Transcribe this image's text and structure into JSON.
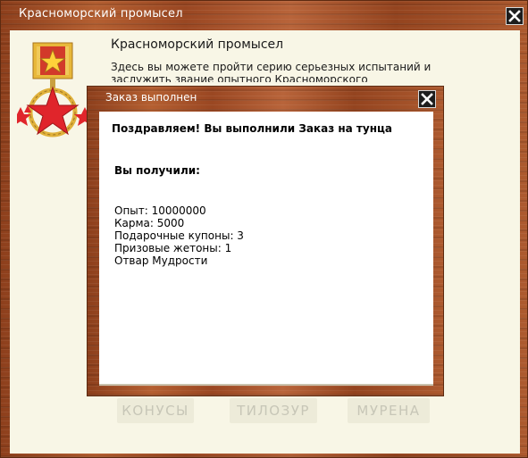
{
  "outer_window": {
    "title": "Красноморский промысел",
    "heading": "Красноморский промысел",
    "description": "Здесь вы можете пройти серию серьезных испытаний и заслужить звание опытного Красноморского",
    "close_icon": "close-icon",
    "medal_icon": "medal-star-icon",
    "tabs": [
      "КОНУСЫ",
      "ТИЛОЗУР",
      "МУРЕНА"
    ]
  },
  "dialog": {
    "title": "Заказ выполнен",
    "close_icon": "close-icon",
    "congrats": "Поздравляем! Вы выполнили Заказ на тунца",
    "received_heading": "Вы получили:",
    "rewards": [
      "Опыт: 10000000",
      "Карма: 5000",
      "Подарочные купоны: 3",
      "Призовые жетоны: 1",
      "Отвар Мудрости"
    ]
  },
  "colors": {
    "wood": "#a4522a",
    "panel": "#f8f6e6",
    "title_text": "#ffffff",
    "medal_red": "#e0252b",
    "medal_gold": "#e8b83a"
  }
}
